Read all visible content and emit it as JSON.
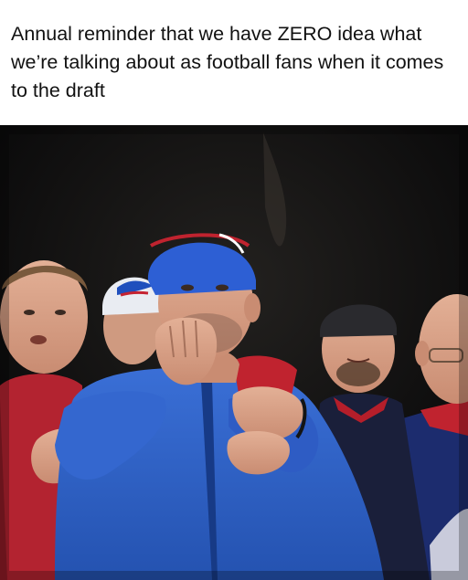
{
  "post": {
    "caption": "Annual reminder that we have ZERO idea what we’re talking about as football fans when it comes to the draft"
  },
  "photo": {
    "subject": "football fans in team gear watching tensely",
    "colors": {
      "background": "#0a0a0c",
      "blue_jacket": "#2f63c9",
      "red_shirt": "#b3232f",
      "navy_jersey": "#1b2b6b",
      "skin": "#d6a184"
    }
  }
}
